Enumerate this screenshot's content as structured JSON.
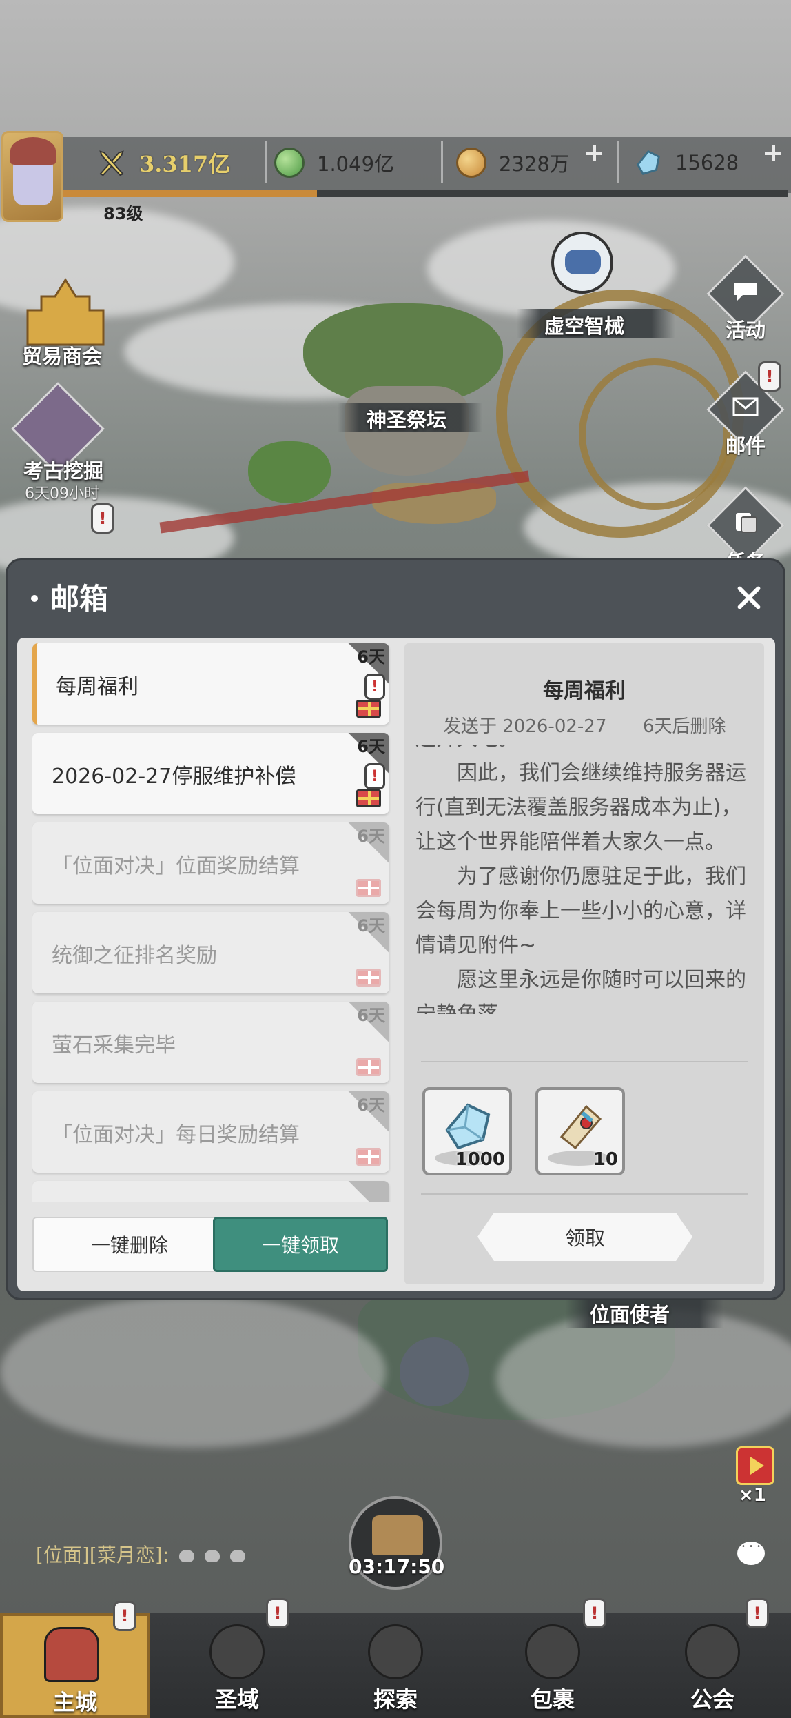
{
  "topbar": {
    "power": "3.317亿",
    "green_orb": "1.049亿",
    "gold": "2328万",
    "crystal": "15628",
    "level": "83级",
    "xp_progress": 0.35
  },
  "map": {
    "trade_guild": "贸易商会",
    "archaeology": "考古挖掘",
    "archaeology_timer": "6天09小时",
    "holy_altar": "神圣祭坛",
    "void_mech": "虚空智械",
    "plane_envoy": "位面使者"
  },
  "side_menu": {
    "activity": "活动",
    "mail": "邮件",
    "tasks": "任务"
  },
  "mailbox": {
    "title": "邮箱",
    "items": [
      {
        "title": "每周福利",
        "days": "6天",
        "state": "selected"
      },
      {
        "title": "2026-02-27停服维护补偿",
        "days": "6天",
        "state": "unread"
      },
      {
        "title": "「位面对决」位面奖励结算",
        "days": "6天",
        "state": "read"
      },
      {
        "title": "统御之征排名奖励",
        "days": "6天",
        "state": "read"
      },
      {
        "title": "萤石采集完毕",
        "days": "6天",
        "state": "read"
      },
      {
        "title": "「位面对决」每日奖励结算",
        "days": "6天",
        "state": "read"
      }
    ],
    "delete_all": "一键删除",
    "claim_all": "一键领取",
    "detail": {
      "title": "每周福利",
      "sent": "发送于 2026-02-27",
      "expires": "6天后删除",
      "cut_line": "送开天地。",
      "paragraph_1": "因此，我们会继续维持服务器运行(直到无法覆盖服务器成本为止)，让这个世界能陪伴着大家久一点。",
      "paragraph_2": "为了感谢你仍愿驻足于此，我们会每周为你奉上一些小小的心意，详情请见附件~",
      "paragraph_3": "愿这里永远是你随时可以回来的宁静角落。。",
      "rewards": [
        {
          "icon": "crystal-icon",
          "count": "1000"
        },
        {
          "icon": "scroll-icon",
          "count": "10"
        }
      ],
      "claim": "领取"
    }
  },
  "chat": {
    "line": "[位面][菜月恋]:"
  },
  "timer": "03:17:50",
  "video": {
    "multiplier": "×1"
  },
  "nav": {
    "main_city": "主城",
    "holy_domain": "圣域",
    "explore": "探索",
    "bag": "包裹",
    "guild": "公会"
  },
  "colors": {
    "accent_teal": "#3f8f7e",
    "selected_marker": "#e4a64c",
    "alert_red": "#c33333"
  }
}
